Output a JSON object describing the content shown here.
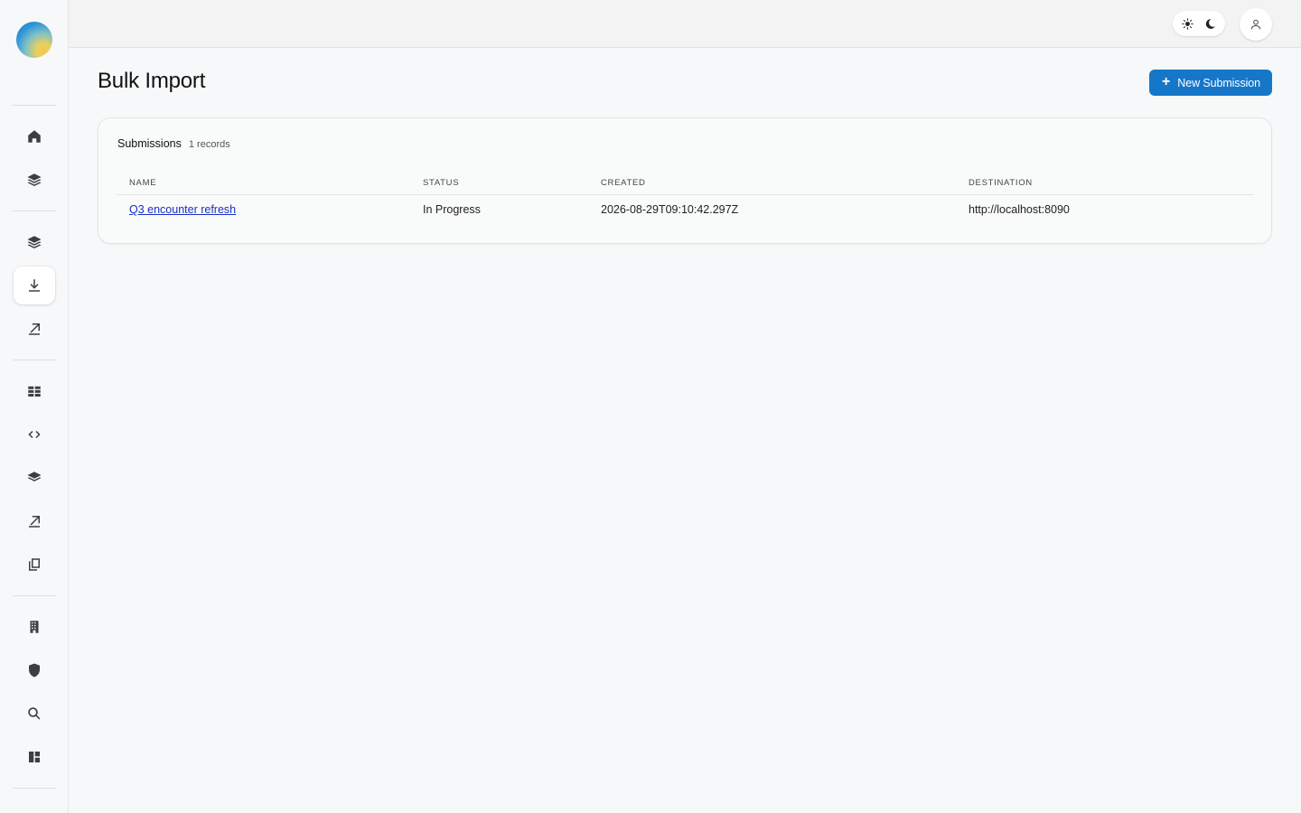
{
  "app": {
    "brand": "logo"
  },
  "sidebar": {
    "items": [
      {
        "icon": "home-icon",
        "name": "nav-home"
      },
      {
        "icon": "layers-icon",
        "name": "nav-layers-1"
      },
      {
        "icon": "layers-icon",
        "name": "nav-layers-2"
      },
      {
        "icon": "download-icon",
        "name": "nav-bulk-import",
        "active": true
      },
      {
        "icon": "upload-icon",
        "name": "nav-export-1"
      },
      {
        "icon": "table-icon",
        "name": "nav-table"
      },
      {
        "icon": "code-icon",
        "name": "nav-code"
      },
      {
        "icon": "layers-icon",
        "name": "nav-layers-3"
      },
      {
        "icon": "upload-icon",
        "name": "nav-export-2"
      },
      {
        "icon": "copy-icon",
        "name": "nav-copy"
      },
      {
        "icon": "building-icon",
        "name": "nav-building"
      },
      {
        "icon": "shield-icon",
        "name": "nav-security"
      },
      {
        "icon": "search-icon",
        "name": "nav-search"
      },
      {
        "icon": "dashboard-icon",
        "name": "nav-dashboard"
      }
    ]
  },
  "topbar": {
    "theme_light_icon": "sun-icon",
    "theme_dark_icon": "moon-icon",
    "account_icon": "user-icon"
  },
  "page": {
    "title": "Bulk Import",
    "new_button_label": "New Submission"
  },
  "submissions": {
    "title": "Submissions",
    "count": "1 records",
    "columns": [
      "NAME",
      "STATUS",
      "CREATED",
      "DESTINATION"
    ],
    "rows": [
      {
        "name": "Q3 encounter refresh",
        "status": "In Progress",
        "created": "2026-08-29T09:10:42.297Z",
        "destination": "http://localhost:8090"
      }
    ]
  },
  "colors": {
    "accent": "#1677c9",
    "link": "#1a2fc7",
    "background": "#f7f8f9"
  }
}
